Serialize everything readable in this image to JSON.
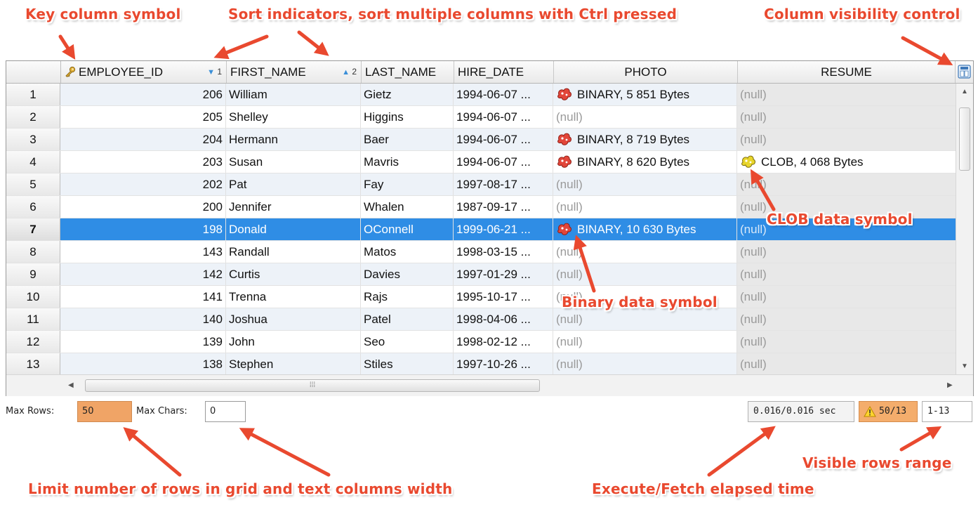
{
  "callouts": {
    "key": "Key column symbol",
    "sort": "Sort indicators, sort multiple columns with Ctrl pressed",
    "visibility": "Column visibility control",
    "clob": "CLOB data symbol",
    "binary": "Binary data symbol",
    "limit": "Limit number of rows in grid and text columns width",
    "elapsed": "Execute/Fetch elapsed time",
    "visible": "Visible rows range"
  },
  "columns": {
    "employee_id": "EMPLOYEE_ID",
    "employee_id_sort": "1",
    "first_name": "FIRST_NAME",
    "first_name_sort": "2",
    "last_name": "LAST_NAME",
    "hire_date": "HIRE_DATE",
    "photo": "PHOTO",
    "resume": "RESUME"
  },
  "rows": [
    {
      "n": "1",
      "id": "206",
      "first": "William",
      "last": "Gietz",
      "hire": "1994-06-07 ...",
      "photo": "BINARY, 5 851 Bytes",
      "resume": "(null)"
    },
    {
      "n": "2",
      "id": "205",
      "first": "Shelley",
      "last": "Higgins",
      "hire": "1994-06-07 ...",
      "photo": "(null)",
      "resume": "(null)"
    },
    {
      "n": "3",
      "id": "204",
      "first": "Hermann",
      "last": "Baer",
      "hire": "1994-06-07 ...",
      "photo": "BINARY, 8 719 Bytes",
      "resume": "(null)"
    },
    {
      "n": "4",
      "id": "203",
      "first": "Susan",
      "last": "Mavris",
      "hire": "1994-06-07 ...",
      "photo": "BINARY, 8 620 Bytes",
      "resume": "CLOB, 4 068 Bytes"
    },
    {
      "n": "5",
      "id": "202",
      "first": "Pat",
      "last": "Fay",
      "hire": "1997-08-17 ...",
      "photo": "(null)",
      "resume": "(null)"
    },
    {
      "n": "6",
      "id": "200",
      "first": "Jennifer",
      "last": "Whalen",
      "hire": "1987-09-17 ...",
      "photo": "(null)",
      "resume": "(null)"
    },
    {
      "n": "7",
      "id": "198",
      "first": "Donald",
      "last": "OConnell",
      "hire": "1999-06-21 ...",
      "photo": "BINARY, 10 630 Bytes",
      "resume": "(null)"
    },
    {
      "n": "8",
      "id": "143",
      "first": "Randall",
      "last": "Matos",
      "hire": "1998-03-15 ...",
      "photo": "(null)",
      "resume": "(null)"
    },
    {
      "n": "9",
      "id": "142",
      "first": "Curtis",
      "last": "Davies",
      "hire": "1997-01-29 ...",
      "photo": "(null)",
      "resume": "(null)"
    },
    {
      "n": "10",
      "id": "141",
      "first": "Trenna",
      "last": "Rajs",
      "hire": "1995-10-17 ...",
      "photo": "(null)",
      "resume": "(null)"
    },
    {
      "n": "11",
      "id": "140",
      "first": "Joshua",
      "last": "Patel",
      "hire": "1998-04-06 ...",
      "photo": "(null)",
      "resume": "(null)"
    },
    {
      "n": "12",
      "id": "139",
      "first": "John",
      "last": "Seo",
      "hire": "1998-02-12 ...",
      "photo": "(null)",
      "resume": "(null)"
    },
    {
      "n": "13",
      "id": "138",
      "first": "Stephen",
      "last": "Stiles",
      "hire": "1997-10-26 ...",
      "photo": "(null)",
      "resume": "(null)"
    }
  ],
  "selected_row": "7",
  "status": {
    "max_rows_label": "Max Rows:",
    "max_rows_value": "50",
    "max_chars_label": "Max Chars:",
    "max_chars_value": "0",
    "elapsed": "0.016/0.016 sec",
    "fetched": "50/13",
    "range": "1-13"
  },
  "icons": {
    "key": "key-icon",
    "binary": "binary-data-icon",
    "clob": "clob-data-icon",
    "visibility": "column-visibility-icon",
    "warning": "warning-icon"
  },
  "colors": {
    "accent": "#e9492f",
    "selection": "#2f8de5",
    "max_rows_bg": "#f0a466"
  }
}
